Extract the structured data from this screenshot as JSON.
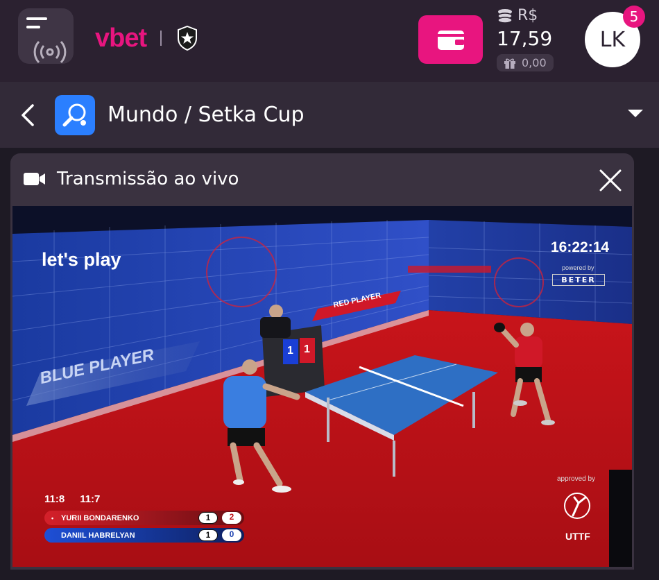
{
  "brand": {
    "name": "vbet",
    "accent": "#e8157f"
  },
  "balance": {
    "currency": "R$",
    "amount": "17,59",
    "bonus": "0,00"
  },
  "user": {
    "initials": "LK",
    "notifications": "5"
  },
  "breadcrumb": {
    "title": "Mundo / Setka Cup"
  },
  "live": {
    "title": "Transmissão ao vivo"
  },
  "video": {
    "overlay": "let's play",
    "clock": "16:22:14",
    "powered_by": "powered by",
    "sponsor": "BETER",
    "blue_player_banner": "BLUE PLAYER",
    "red_player_banner": "RED PLAYER",
    "approved_by": "approved by",
    "federation": "UTTF",
    "set_scores": [
      "11:8",
      "11:7"
    ],
    "players": [
      {
        "name": "YURII BONDARENKO",
        "serving": "•",
        "sets": "1",
        "points": "2"
      },
      {
        "name": "DANIIL HABRELYAN",
        "serving": "",
        "sets": "1",
        "points": "0"
      }
    ],
    "scoreboard": {
      "left": "1",
      "right": "1"
    }
  },
  "icons": [
    "menu-icon",
    "live-radio-icon",
    "club-shield-icon",
    "wallet-icon",
    "coins-icon",
    "gift-icon",
    "back-chevron-icon",
    "table-tennis-icon",
    "chevron-down-icon",
    "video-camera-icon",
    "close-icon"
  ]
}
